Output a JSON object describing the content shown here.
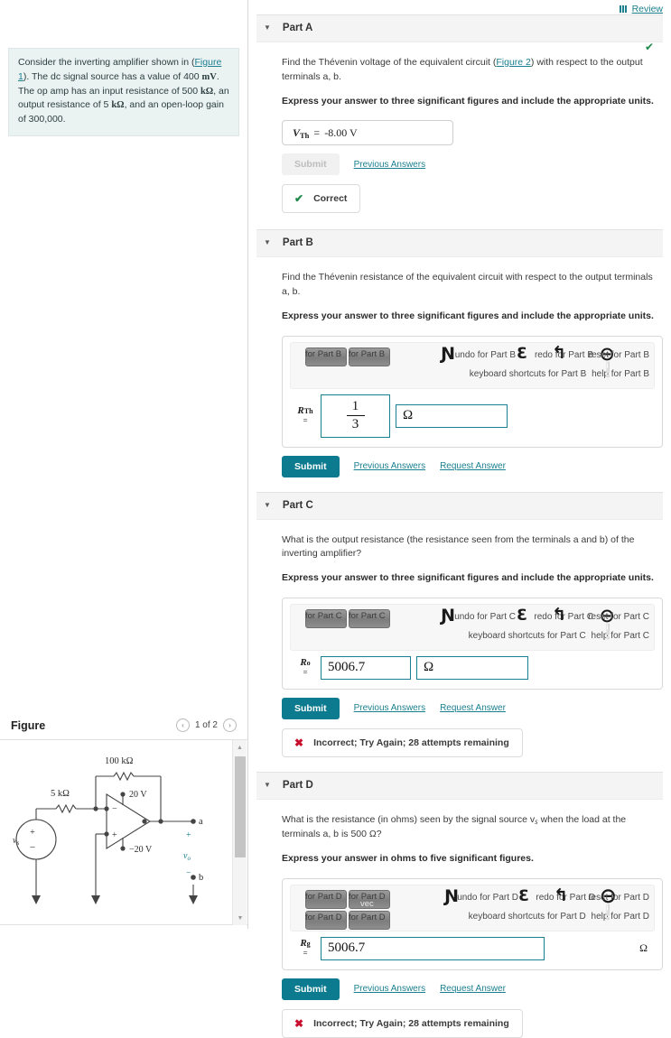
{
  "review": {
    "label": "Review",
    "icon": "columns-icon"
  },
  "problem": {
    "text_parts": [
      "Consider the inverting amplifier shown in (",
      "Figure 1",
      "). The dc signal source has a value of 400 ",
      "mV",
      ". The op amp has an input resistance of 500 ",
      "kΩ",
      ", an output resistance of 5 ",
      "kΩ",
      ", and an open-loop gain of 300,000."
    ],
    "figure_link": "Figure 1",
    "value_source": "400 mV",
    "input_resistance": "500 kΩ",
    "output_resistance": "5 kΩ",
    "open_loop_gain": "300,000"
  },
  "figure_panel": {
    "title": "Figure",
    "pager": {
      "prev": "‹",
      "label": "1 of 2",
      "next": "›"
    },
    "circuit": {
      "feedback_resistor": "100 kΩ",
      "input_resistor": "5 kΩ",
      "supply_positive": "20 V",
      "supply_negative": "−20 V",
      "source_label": "v",
      "source_sub": "s",
      "terminal_a": "a",
      "terminal_b": "b",
      "output_label": "v",
      "output_sub": "o",
      "polarity_plus": "+",
      "polarity_minus": "−",
      "opamp_minus": "−",
      "opamp_plus": "+"
    }
  },
  "parts": [
    {
      "id": "A",
      "title": "Part A",
      "status": "correct",
      "prompt_pre": "Find the Thévenin voltage of the equivalent circuit (",
      "prompt_link": "Figure 2",
      "prompt_post": ") with respect to the output terminals a, b.",
      "instruction": "Express your answer to three significant figures and include the appropriate units.",
      "answer_label": "V",
      "answer_sub": "Th",
      "answer_eq": "=",
      "answer_value": "-8.00 V",
      "submit_label": "Submit",
      "submit_disabled": true,
      "previous_answers": "Previous Answers",
      "request_answer": null,
      "feedback": "Correct",
      "feedback_type": "ok"
    },
    {
      "id": "B",
      "title": "Part B",
      "status": "open",
      "prompt_pre": "Find the Thévenin resistance of the equivalent circuit with respect to the output terminals a, b.",
      "prompt_link": null,
      "prompt_post": "",
      "instruction": "Express your answer to three significant figures and include the appropriate units.",
      "answer_label": "R",
      "answer_sub": "Th",
      "answer_eq": "=",
      "answer_kind": "fraction",
      "numerator": "1",
      "denominator": "3",
      "unit_value": "Ω",
      "submit_label": "Submit",
      "submit_disabled": false,
      "previous_answers": "Previous Answers",
      "request_answer": "Request Answer",
      "feedback": null,
      "feedback_type": null,
      "toolbar": {
        "buttons": [
          "for Part B",
          "for Part B"
        ],
        "undo": "undo for Part B",
        "redo": "redo for Part B",
        "reset": "reset for Part B",
        "keyboard_shortcuts": "keyboard shortcuts for Part B",
        "help": "help for Part B"
      }
    },
    {
      "id": "C",
      "title": "Part C",
      "status": "open",
      "prompt_pre": "What is the output resistance (the resistance seen from the terminals a and b) of the inverting amplifier?",
      "prompt_link": null,
      "prompt_post": "",
      "instruction": "Express your answer to three significant figures and include the appropriate units.",
      "answer_label": "R",
      "answer_sub": "o",
      "answer_eq": "=",
      "answer_kind": "plain",
      "answer_value": "5006.7",
      "unit_value": "Ω",
      "submit_label": "Submit",
      "submit_disabled": false,
      "previous_answers": "Previous Answers",
      "request_answer": "Request Answer",
      "feedback": "Incorrect; Try Again; 28 attempts remaining",
      "feedback_type": "bad",
      "toolbar": {
        "buttons": [
          "for Part C",
          "for Part C"
        ],
        "undo": "undo for Part C",
        "redo": "redo for Part C",
        "reset": "reset for Part C",
        "keyboard_shortcuts": "keyboard shortcuts for Part C",
        "help": "help for Part C"
      }
    },
    {
      "id": "D",
      "title": "Part D",
      "status": "open",
      "prompt_pre": "What is the resistance (in ohms) seen by the signal source v",
      "prompt_sub": "s",
      "prompt_post": " when the load at the terminals a, b is 500 Ω?",
      "instruction": "Express your answer in ohms to five significant figures.",
      "answer_label": "R",
      "answer_sub": "g",
      "answer_eq": "=",
      "answer_kind": "plain-long",
      "answer_value": "5006.7",
      "unit_value": "Ω",
      "submit_label": "Submit",
      "submit_disabled": false,
      "previous_answers": "Previous Answers",
      "request_answer": "Request Answer",
      "feedback": "Incorrect; Try Again; 28 attempts remaining",
      "feedback_type": "bad",
      "toolbar": {
        "buttons": [
          "for Part D",
          "for Part D",
          "for Part D",
          "for Part D"
        ],
        "vec_label": "vec",
        "undo": "undo for Part D",
        "redo": "redo for Part D",
        "reset": "reset for Part D",
        "keyboard_shortcuts": "keyboard shortcuts for Part D",
        "help": "help for Part D"
      }
    }
  ],
  "colors": {
    "accent": "#0d7b8f",
    "link": "#1a7f8e",
    "correct": "#1d8a4a",
    "incorrect": "#c8102e",
    "problem_bg": "#eaf2f2"
  }
}
